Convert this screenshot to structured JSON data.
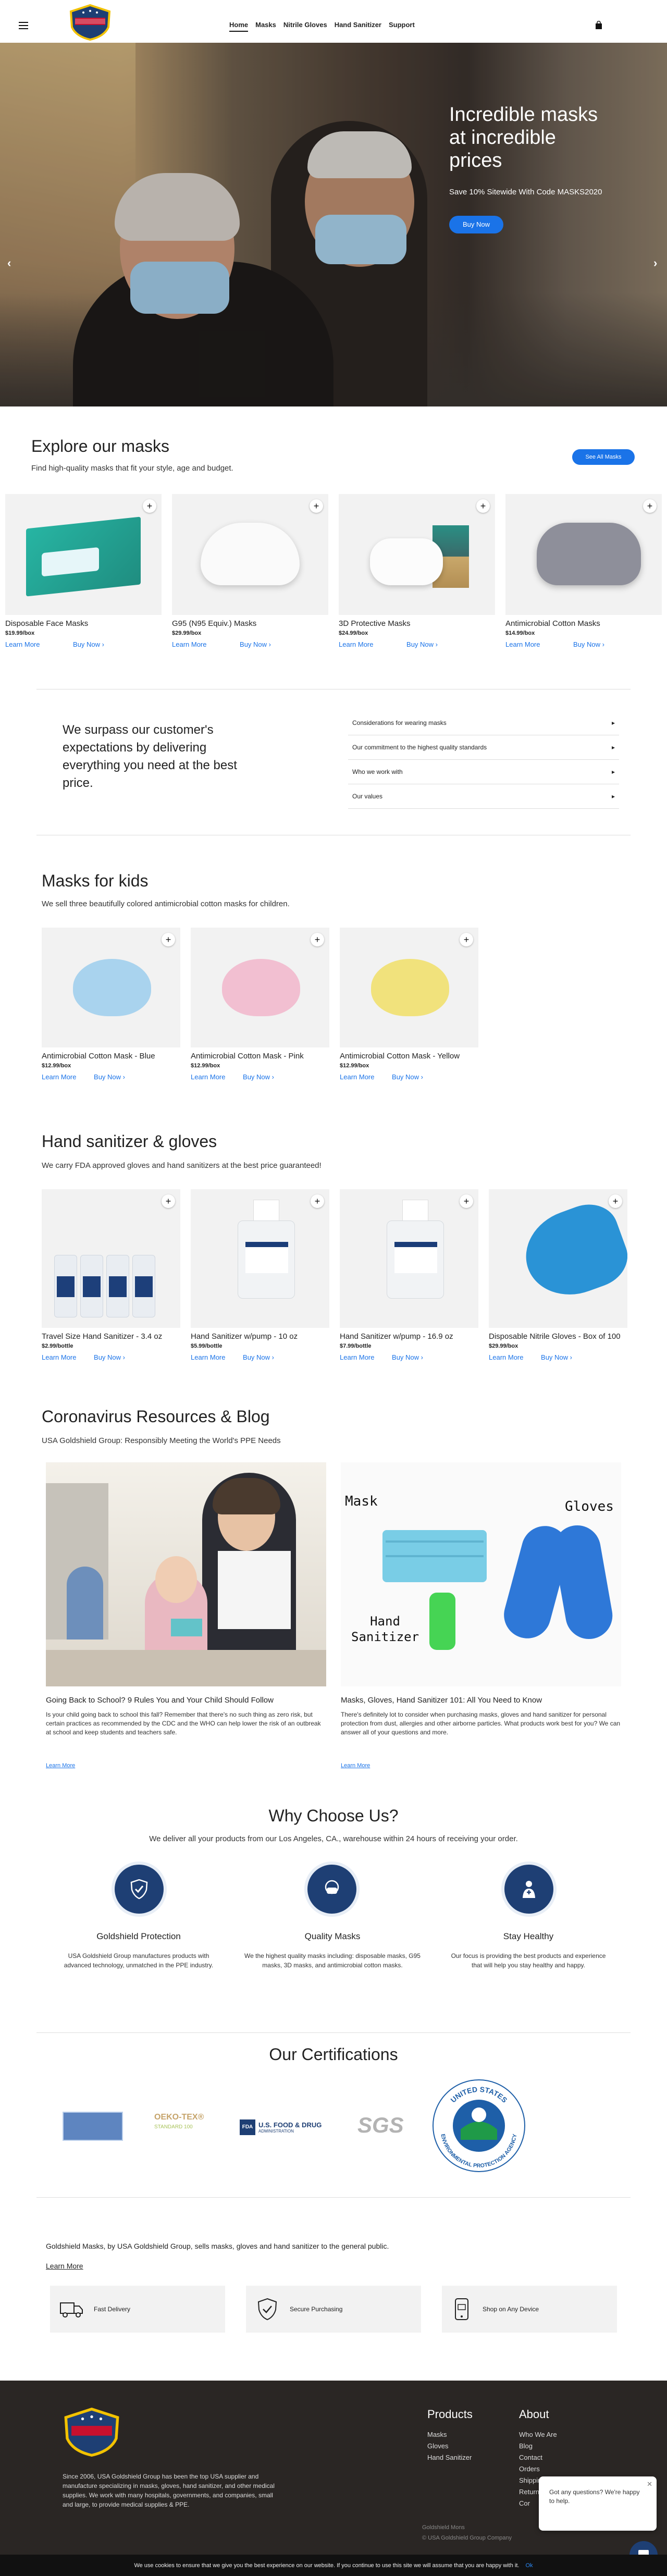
{
  "header": {
    "nav": [
      "Home",
      "Masks",
      "Nitrile Gloves",
      "Hand Sanitizer",
      "Support"
    ]
  },
  "hero": {
    "title": "Incredible masks at incredible prices",
    "subtitle": "Save 10% Sitewide With Code MASKS2020",
    "button": "Buy Now",
    "prev": "‹",
    "next": "›"
  },
  "explore": {
    "title": "Explore our masks",
    "subtitle": "Find high-quality masks that fit your style, age and budget.",
    "see_all": "See All Masks",
    "products": [
      {
        "name": "Disposable Face Masks",
        "price": "$19.99/box",
        "learn": "Learn More",
        "buy": "Buy Now ›"
      },
      {
        "name": "G95 (N95 Equiv.) Masks",
        "price": "$29.99/box",
        "learn": "Learn More",
        "buy": "Buy Now ›"
      },
      {
        "name": "3D Protective Masks",
        "price": "$24.99/box",
        "learn": "Learn More",
        "buy": "Buy Now ›"
      },
      {
        "name": "Antimicrobial Cotton Masks",
        "price": "$14.99/box",
        "learn": "Learn More",
        "buy": "Buy Now ›"
      }
    ]
  },
  "values": {
    "title": "We surpass our customer's expectations by delivering everything you need at the best price.",
    "items": [
      "Considerations for wearing masks",
      "Our commitment to the highest quality standards",
      "Who we work with",
      "Our values"
    ]
  },
  "kids": {
    "title": "Masks for kids",
    "subtitle": "We sell three beautifully colored antimicrobial cotton masks for children.",
    "products": [
      {
        "name": "Antimicrobial Cotton Mask - Blue",
        "price": "$12.99/box",
        "learn": "Learn More",
        "buy": "Buy Now ›",
        "color": "#a9d3ee"
      },
      {
        "name": "Antimicrobial Cotton Mask - Pink",
        "price": "$12.99/box",
        "learn": "Learn More",
        "buy": "Buy Now ›",
        "color": "#f2bfd1"
      },
      {
        "name": "Antimicrobial Cotton Mask - Yellow",
        "price": "$12.99/box",
        "learn": "Learn More",
        "buy": "Buy Now ›",
        "color": "#f1e27c"
      }
    ]
  },
  "sanitizer": {
    "title": "Hand sanitizer & gloves",
    "subtitle": "We carry FDA approved gloves and hand sanitizers at the best price guaranteed!",
    "products": [
      {
        "name": "Travel Size Hand Sanitizer - 3.4 oz",
        "price": "$2.99/bottle",
        "learn": "Learn More",
        "buy": "Buy Now ›"
      },
      {
        "name": "Hand Sanitizer w/pump - 10 oz",
        "price": "$5.99/bottle",
        "learn": "Learn More",
        "buy": "Buy Now ›"
      },
      {
        "name": "Hand Sanitizer w/pump - 16.9 oz",
        "price": "$7.99/bottle",
        "learn": "Learn More",
        "buy": "Buy Now ›"
      },
      {
        "name": "Disposable Nitrile Gloves - Box of 100",
        "price": "$29.99/box",
        "learn": "Learn More",
        "buy": "Buy Now ›"
      }
    ]
  },
  "blog": {
    "title": "Coronavirus Resources & Blog",
    "subtitle": "USA Goldshield Group: Responsibly Meeting the World's PPE Needs",
    "posts": [
      {
        "title": "Going Back to School? 9 Rules You and Your Child Should Follow",
        "text": "Is your child going back to school this fall? Remember that there's no such thing as zero risk, but certain practices as recommended by the CDC and the WHO can help lower the risk of an outbreak at school and keep students and teachers safe.",
        "link": "Learn More"
      },
      {
        "title": "Masks, Gloves, Hand Sanitizer 101: All You Need to Know",
        "text": "There's definitely lot to consider when purchasing masks, gloves and hand sanitizer for personal protection from dust, allergies and other airborne particles. What products work best for you? We can answer all of your questions and more.",
        "link": "Learn More",
        "img_labels": [
          "Mask",
          "Gloves S",
          "Hand Sanitizer"
        ]
      }
    ]
  },
  "why": {
    "title": "Why Choose Us?",
    "subtitle": "We deliver all your products from our Los Angeles, CA., warehouse within 24 hours of receiving your order.",
    "items": [
      {
        "title": "Goldshield Protection",
        "text": "USA Goldshield Group manufactures products with advanced technology, unmatched in the PPE industry."
      },
      {
        "title": "Quality Masks",
        "text": "We the highest quality masks including: disposable masks, G95 masks, 3D masks, and antimicrobial cotton masks."
      },
      {
        "title": "Stay Healthy",
        "text": "Our focus is providing the best products and experience that will help you stay healthy and happy."
      }
    ]
  },
  "certs": {
    "title": "Our Certifications",
    "oeko": "OEKO-TEX®",
    "oeko_sub": "STANDARD 100",
    "fda": "U.S. FOOD & DRUG",
    "fda_sub": "ADMINISTRATION",
    "sgs": "SGS",
    "epa_top": "UNITED STATES",
    "epa_bottom": "ENVIRONMENTAL PROTECTION AGENCY"
  },
  "about": {
    "text": "Goldshield Masks, by USA Goldshield Group, sells masks, gloves and hand sanitizer to the general public.",
    "link": "Learn More"
  },
  "features": [
    "Fast Delivery",
    "Secure Purchasing",
    "Shop on Any Device"
  ],
  "footer": {
    "text": "Since 2006, USA Goldshield Group has been the top USA supplier and manufacture specializing in masks, gloves, hand sanitizer, and other medical supplies. We work with many hospitals, governments, and companies, small and large, to provide medical supplies & PPE.",
    "products_title": "Products",
    "products": [
      "Masks",
      "Gloves",
      "Hand Sanitizer"
    ],
    "about_title": "About",
    "about": [
      "Who We Are",
      "Blog",
      "Contact",
      "Orders",
      "Shipping",
      "Returns",
      "Cor"
    ],
    "bottom_left": "Goldshield Mons",
    "copyright": "© USA Goldshield Group Company"
  },
  "chat": {
    "message": "Got any questions? We're happy to help.",
    "close": "✕"
  },
  "cookie": {
    "text": "We use cookies to ensure that we give you the best experience on our website. If you continue to use this site we will assume that you are happy with it.",
    "ok": "Ok"
  },
  "colors": {
    "accent": "#1a73e8",
    "navy": "#1e3f74",
    "footer_bg": "#2a2624"
  }
}
